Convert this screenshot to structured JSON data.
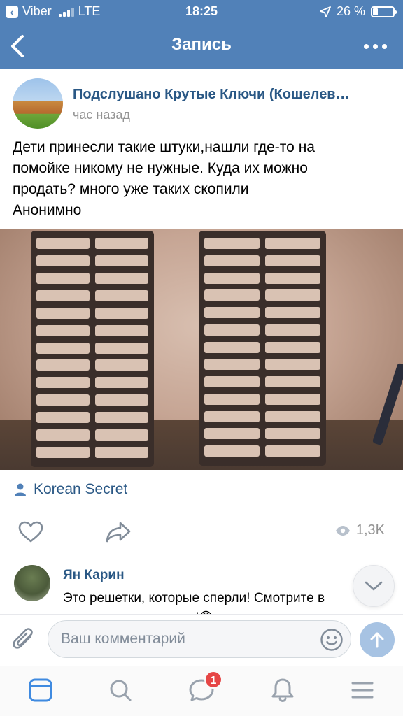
{
  "status_bar": {
    "carrier": "Viber",
    "network": "LTE",
    "time": "18:25",
    "battery": "26 %",
    "battery_level": 0.26
  },
  "navbar": {
    "title": "Запись"
  },
  "post": {
    "group_name": "Подслушано Крутые Ключи (Кошелев…",
    "time": "час назад",
    "text_lines": [
      "Дети принесли такие штуки,нашли где-то на",
      "помойке никому не нужные. Куда их можно",
      "продать? много уже таких скопили",
      "Анонимно"
    ],
    "author": "Korean Secret",
    "views": "1,3K"
  },
  "comment": {
    "name": "Ян Карин",
    "text": "Это решетки, которые сперли! Смотрите в группе, ранее писали!😡"
  },
  "comment_input": {
    "placeholder": "Ваш комментарий"
  },
  "tabbar": {
    "messages_badge": "1"
  },
  "colors": {
    "header": "#5181b8",
    "link": "#2a5885",
    "badge": "#e64646"
  }
}
